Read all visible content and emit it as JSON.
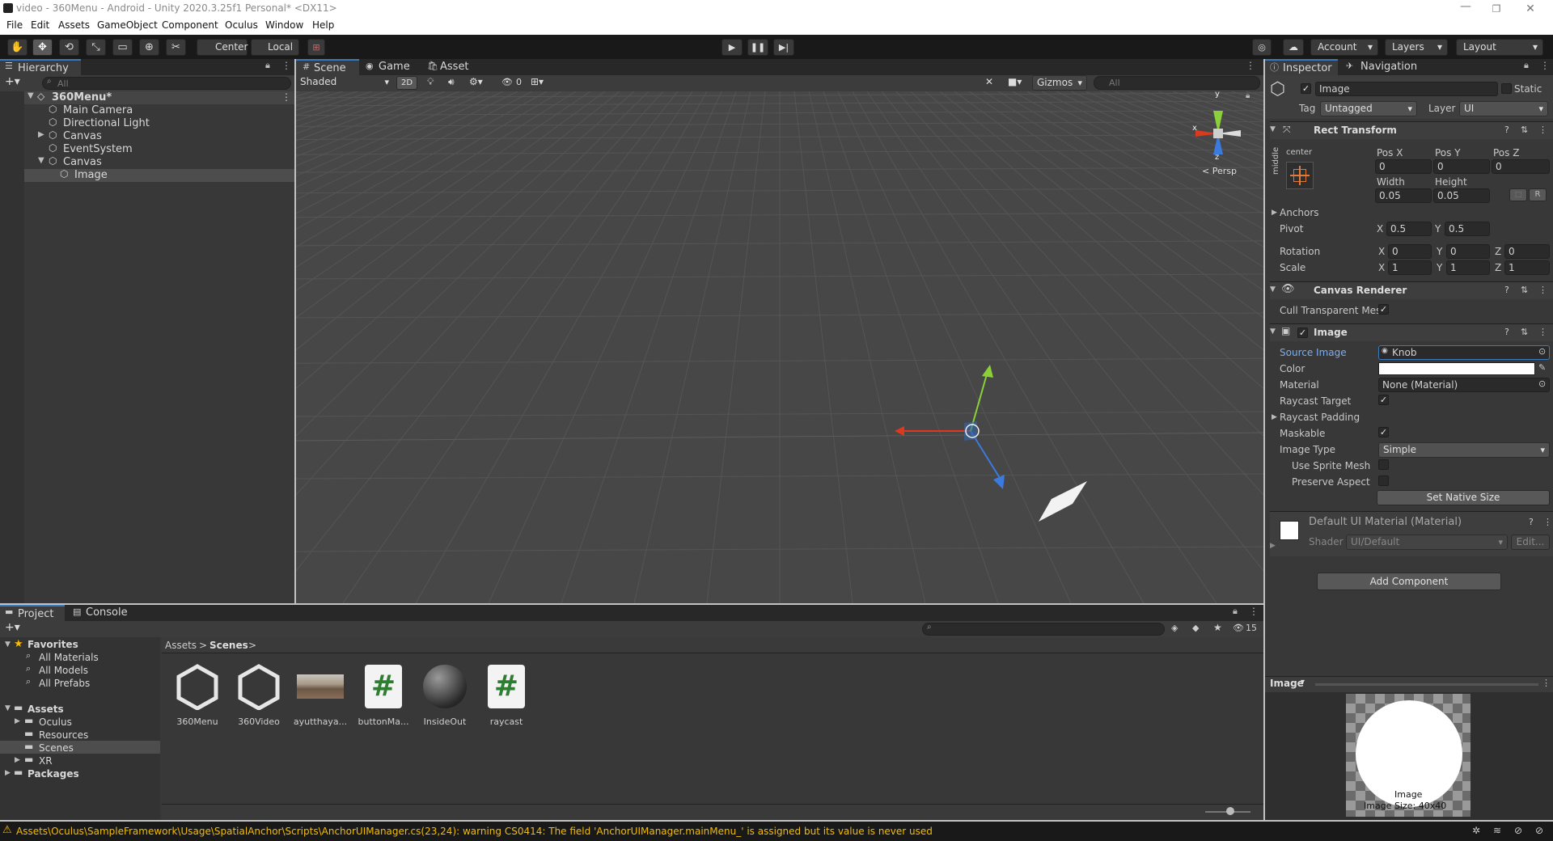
{
  "window": {
    "title": "video - 360Menu - Android - Unity 2020.3.25f1 Personal* <DX11>"
  },
  "menu": [
    "File",
    "Edit",
    "Assets",
    "GameObject",
    "Component",
    "Oculus",
    "Window",
    "Help"
  ],
  "toolbar": {
    "center": "Center",
    "local": "Local",
    "account": "Account",
    "layers": "Layers",
    "layout": "Layout"
  },
  "hierarchy": {
    "tab": "Hierarchy",
    "search_placeholder": "All",
    "scene": "360Menu*",
    "items": [
      "Main Camera",
      "Directional Light",
      "Canvas",
      "EventSystem",
      "Canvas",
      "Image"
    ]
  },
  "scene": {
    "tabs": [
      "Scene",
      "Game",
      "Asset Store"
    ],
    "shading": "Shaded",
    "mode2d": "2D",
    "hidden_count": "0",
    "gizmos": "Gizmos",
    "search_placeholder": "All",
    "persp": "< Persp",
    "axis": {
      "x": "x",
      "y": "y",
      "z": "z"
    }
  },
  "inspector": {
    "tabs": [
      "Inspector",
      "Navigation"
    ],
    "object_name": "Image",
    "static": "Static",
    "tag_label": "Tag",
    "tag": "Untagged",
    "layer_label": "Layer",
    "layer": "UI",
    "rect": {
      "title": "Rect Transform",
      "anchor_h": "center",
      "anchor_v": "middle",
      "posx_label": "Pos X",
      "posy_label": "Pos Y",
      "posz_label": "Pos Z",
      "posx": "0",
      "posy": "0",
      "posz": "0",
      "width_label": "Width",
      "height_label": "Height",
      "width": "0.05",
      "height": "0.05",
      "r_button": "R",
      "anchors": "Anchors",
      "pivot": "Pivot",
      "pivot_x": "0.5",
      "pivot_y": "0.5",
      "rotation": "Rotation",
      "rot_x": "0",
      "rot_y": "0",
      "rot_z": "0",
      "scale": "Scale",
      "sc_x": "1",
      "sc_y": "1",
      "sc_z": "1",
      "x": "X",
      "y": "Y",
      "z": "Z"
    },
    "canvas_renderer": {
      "title": "Canvas Renderer",
      "cull": "Cull Transparent Mes"
    },
    "image": {
      "title": "Image",
      "source_label": "Source Image",
      "source": "Knob",
      "color_label": "Color",
      "material_label": "Material",
      "material": "None (Material)",
      "raycast_target": "Raycast Target",
      "raycast_padding": "Raycast Padding",
      "maskable": "Maskable",
      "image_type_label": "Image Type",
      "image_type": "Simple",
      "use_sprite_mesh": "Use Sprite Mesh",
      "preserve_aspect": "Preserve Aspect",
      "native_size": "Set Native Size"
    },
    "material": {
      "title": "Default UI Material (Material)",
      "shader_label": "Shader",
      "shader": "UI/Default",
      "edit": "Edit..."
    },
    "add_component": "Add Component",
    "preview": {
      "title": "Image",
      "caption1": "Image",
      "caption2": "Image Size: 40x40"
    }
  },
  "project": {
    "tabs": [
      "Project",
      "Console"
    ],
    "favorites": "Favorites",
    "fav_items": [
      "All Materials",
      "All Models",
      "All Prefabs"
    ],
    "assets": "Assets",
    "asset_folders": [
      "Oculus",
      "Resources",
      "Scenes",
      "XR"
    ],
    "packages": "Packages",
    "breadcrumb": [
      "Assets",
      "Scenes"
    ],
    "hidden_count": "15",
    "files": [
      {
        "name": "360Menu",
        "kind": "unity"
      },
      {
        "name": "360Video",
        "kind": "unity"
      },
      {
        "name": "ayutthaya...",
        "kind": "image"
      },
      {
        "name": "buttonMa...",
        "kind": "script"
      },
      {
        "name": "InsideOut",
        "kind": "sphere"
      },
      {
        "name": "raycast",
        "kind": "script"
      }
    ]
  },
  "status": {
    "warning": "Assets\\Oculus\\SampleFramework\\Usage\\SpatialAnchor\\Scripts\\AnchorUIManager.cs(23,24): warning CS0414: The field 'AnchorUIManager.mainMenu_' is assigned but its value is never used"
  },
  "colors": {
    "accent": "#3a79bb",
    "warning": "#f4bc02",
    "panel": "#383838",
    "scene_bg": "#474747"
  }
}
